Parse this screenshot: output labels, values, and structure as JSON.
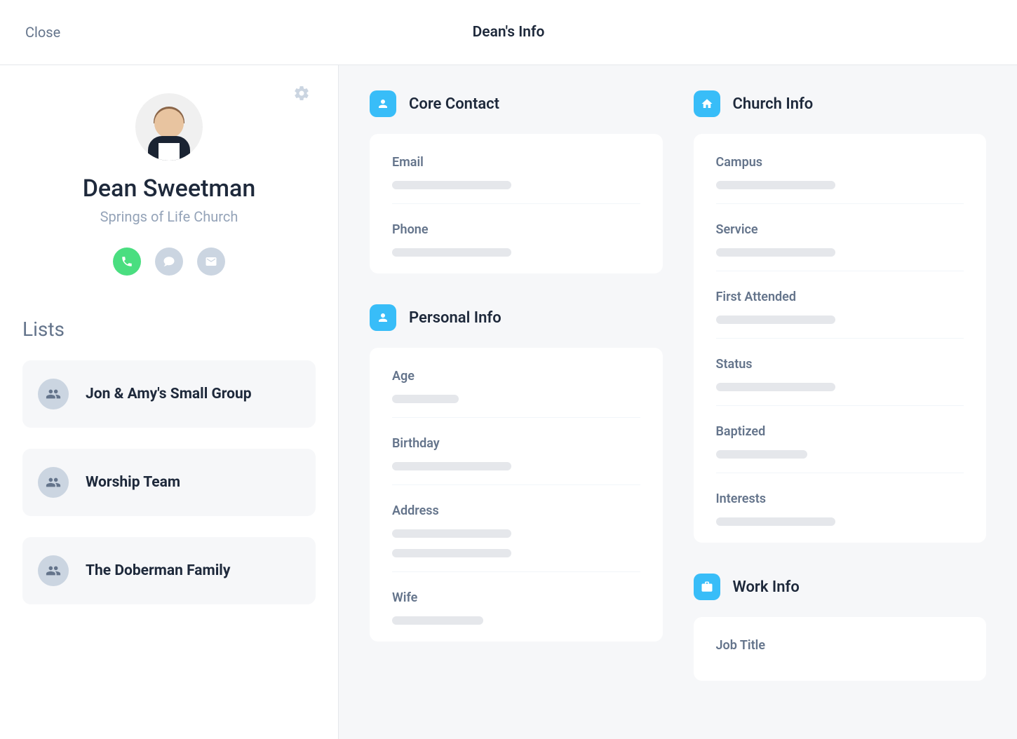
{
  "header": {
    "close_label": "Close",
    "title": "Dean's Info"
  },
  "profile": {
    "name": "Dean Sweetman",
    "organization": "Springs of Life Church"
  },
  "lists": {
    "heading": "Lists",
    "items": [
      {
        "label": "Jon & Amy's Small Group"
      },
      {
        "label": "Worship Team"
      },
      {
        "label": "The Doberman Family"
      }
    ]
  },
  "sections": {
    "core_contact": {
      "title": "Core Contact",
      "fields": [
        {
          "label": "Email"
        },
        {
          "label": "Phone"
        }
      ]
    },
    "personal_info": {
      "title": "Personal Info",
      "fields": [
        {
          "label": "Age"
        },
        {
          "label": "Birthday"
        },
        {
          "label": "Address"
        },
        {
          "label": "Wife"
        }
      ]
    },
    "church_info": {
      "title": "Church Info",
      "fields": [
        {
          "label": "Campus"
        },
        {
          "label": "Service"
        },
        {
          "label": "First Attended"
        },
        {
          "label": "Status"
        },
        {
          "label": "Baptized"
        },
        {
          "label": "Interests"
        }
      ]
    },
    "work_info": {
      "title": "Work Info",
      "fields": [
        {
          "label": "Job Title"
        }
      ]
    }
  },
  "colors": {
    "accent": "#38bdf8",
    "call_button": "#4ade80",
    "muted_button": "#cbd5e1"
  }
}
